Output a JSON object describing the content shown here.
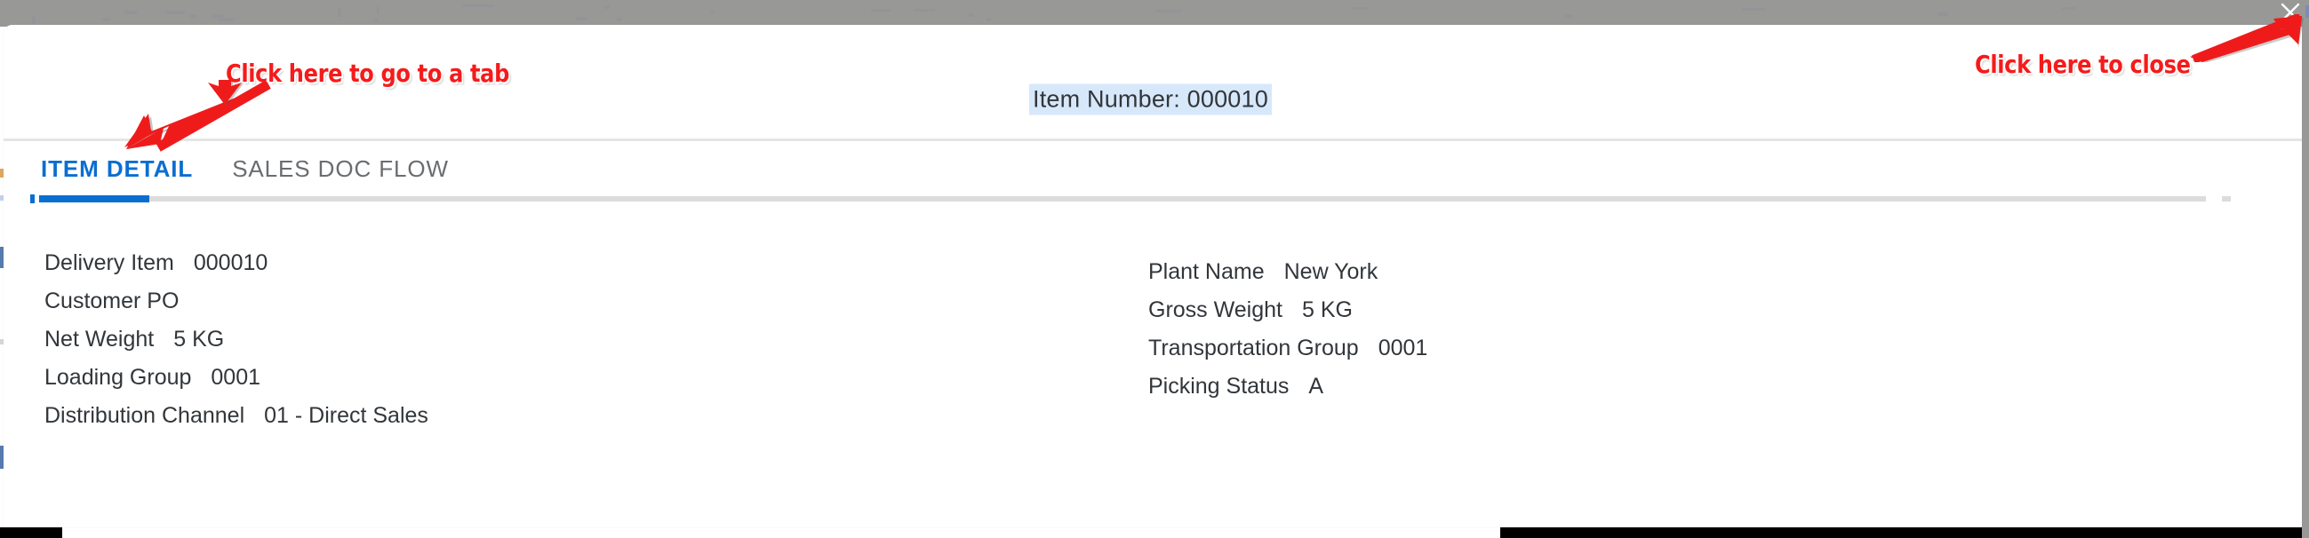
{
  "overlay": {
    "close_icon": "close-icon",
    "close_label": "×"
  },
  "dialog": {
    "header": {
      "item_number": "Item Number: 000010"
    },
    "tabs": [
      {
        "id": "item-detail",
        "label": "ITEM DETAIL",
        "active": true
      },
      {
        "id": "sales-doc-flow",
        "label": "SALES DOC FLOW",
        "active": false
      }
    ],
    "detail": {
      "left_column": [
        {
          "label": "Delivery Item",
          "value": "000010"
        },
        {
          "label": "Customer PO",
          "value": ""
        },
        {
          "label": "Net Weight",
          "value": "5 KG"
        },
        {
          "label": "Loading Group",
          "value": "0001"
        },
        {
          "label": "Distribution Channel",
          "value": "01 - Direct Sales"
        }
      ],
      "right_column": [
        {
          "label": "Plant Name",
          "value": "New York"
        },
        {
          "label": "Gross Weight",
          "value": "5 KG"
        },
        {
          "label": "Transportation Group",
          "value": "0001"
        },
        {
          "label": "Picking Status",
          "value": "A"
        }
      ]
    }
  },
  "annotations": [
    {
      "id": "tab-hint",
      "text": "Click here to go to a tab"
    },
    {
      "id": "close-hint",
      "text": "Click here to close"
    }
  ],
  "colors": {
    "accent_blue": "#0a6ed1",
    "annotation_red": "#f51b1b",
    "overlay_gray": "#989897",
    "highlight_blue": "#d7e8fb",
    "text_dark": "#32363a",
    "text_muted": "#6a6d70",
    "track_gray": "#dcdcdc"
  }
}
